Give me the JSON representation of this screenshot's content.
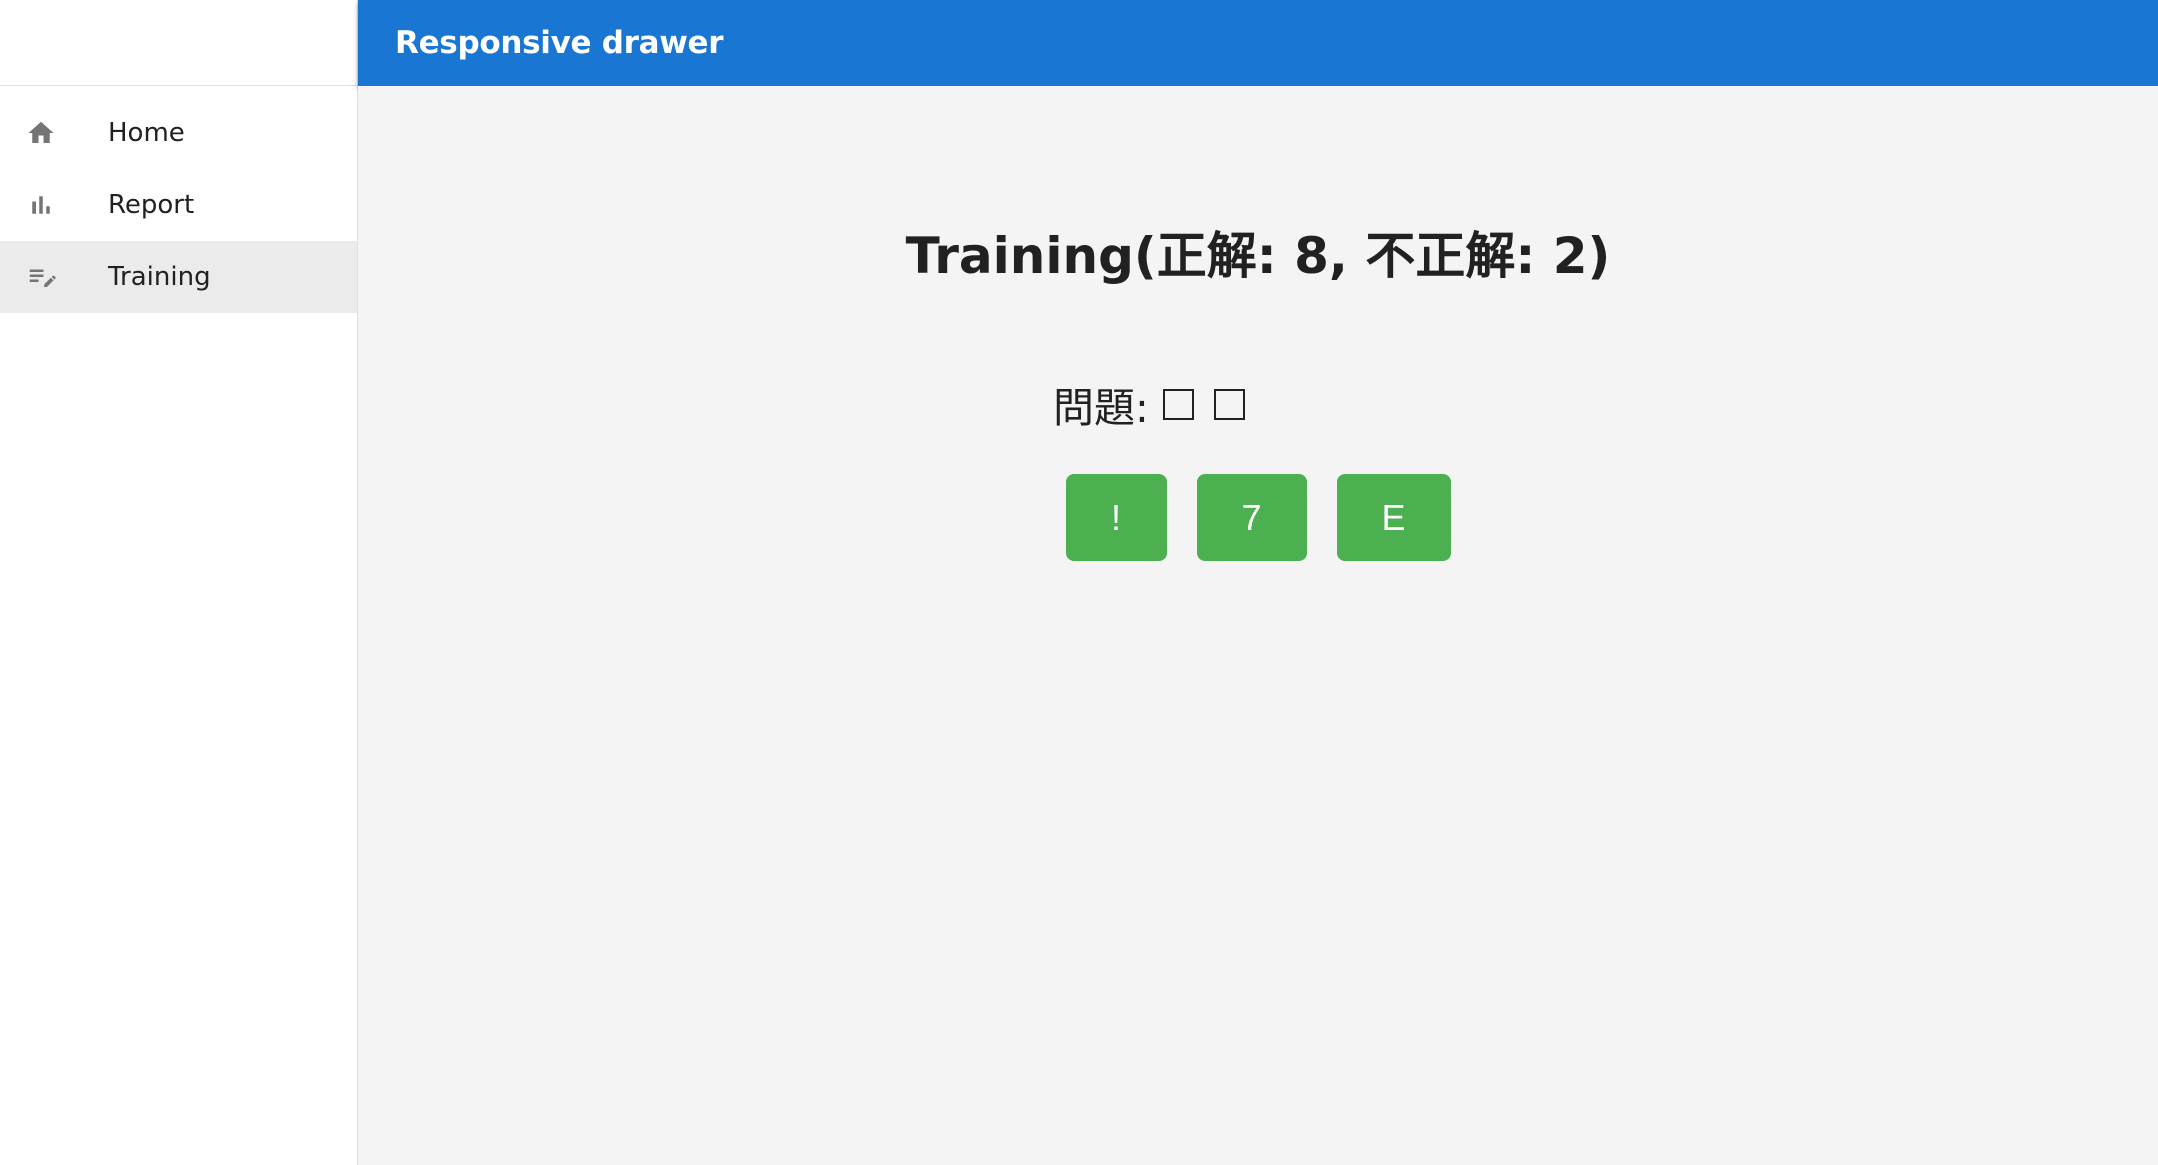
{
  "appbar": {
    "title": "Responsive drawer"
  },
  "sidebar": {
    "items": [
      {
        "label": "Home",
        "icon": "home-icon",
        "selected": false
      },
      {
        "label": "Report",
        "icon": "bar-chart-icon",
        "selected": false
      },
      {
        "label": "Training",
        "icon": "edit-note-icon",
        "selected": true
      }
    ]
  },
  "main": {
    "title": "Training(正解: 8, 不正解: 2)",
    "question_label": "問題:",
    "answers": [
      {
        "label": "!"
      },
      {
        "label": "7"
      },
      {
        "label": "E"
      }
    ]
  },
  "colors": {
    "appbar": "#1976d2",
    "answer_button": "#4caf50",
    "main_background": "#f4f4f4",
    "selected_item": "#ebebeb"
  }
}
